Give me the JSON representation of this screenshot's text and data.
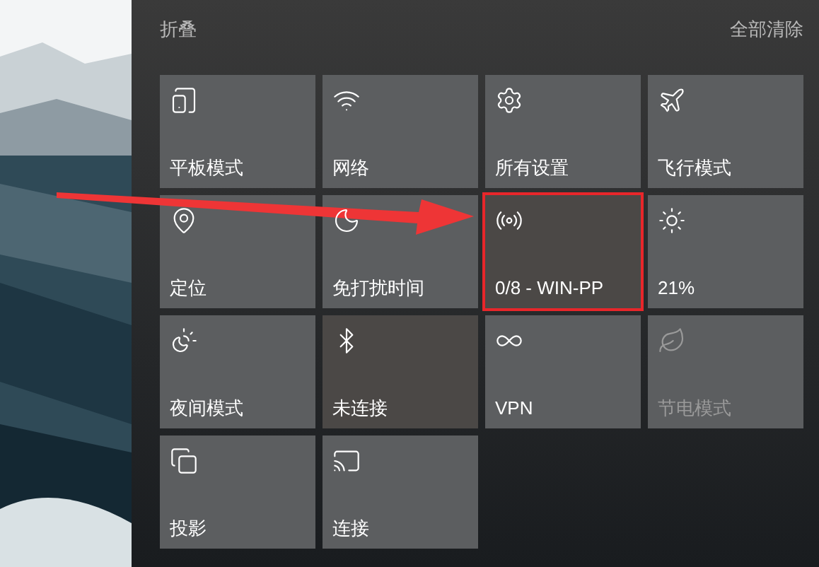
{
  "header": {
    "collapse": "折叠",
    "clear_all": "全部清除"
  },
  "tiles": [
    {
      "label": "平板模式",
      "highlighted": false,
      "disabled": false,
      "annotated": false
    },
    {
      "label": "网络",
      "highlighted": false,
      "disabled": false,
      "annotated": false
    },
    {
      "label": "所有设置",
      "highlighted": false,
      "disabled": false,
      "annotated": false
    },
    {
      "label": "飞行模式",
      "highlighted": false,
      "disabled": false,
      "annotated": false
    },
    {
      "label": "定位",
      "highlighted": false,
      "disabled": false,
      "annotated": false
    },
    {
      "label": "免打扰时间",
      "highlighted": false,
      "disabled": false,
      "annotated": false
    },
    {
      "label": "0/8 - WIN-PP",
      "highlighted": true,
      "disabled": false,
      "annotated": true
    },
    {
      "label": "21%",
      "highlighted": false,
      "disabled": false,
      "annotated": false
    },
    {
      "label": "夜间模式",
      "highlighted": false,
      "disabled": false,
      "annotated": false
    },
    {
      "label": "未连接",
      "highlighted": true,
      "disabled": false,
      "annotated": false
    },
    {
      "label": "VPN",
      "highlighted": false,
      "disabled": false,
      "annotated": false
    },
    {
      "label": "节电模式",
      "highlighted": false,
      "disabled": true,
      "annotated": false
    },
    {
      "label": "投影",
      "highlighted": false,
      "disabled": false,
      "annotated": false
    },
    {
      "label": "连接",
      "highlighted": false,
      "disabled": false,
      "annotated": false
    }
  ]
}
